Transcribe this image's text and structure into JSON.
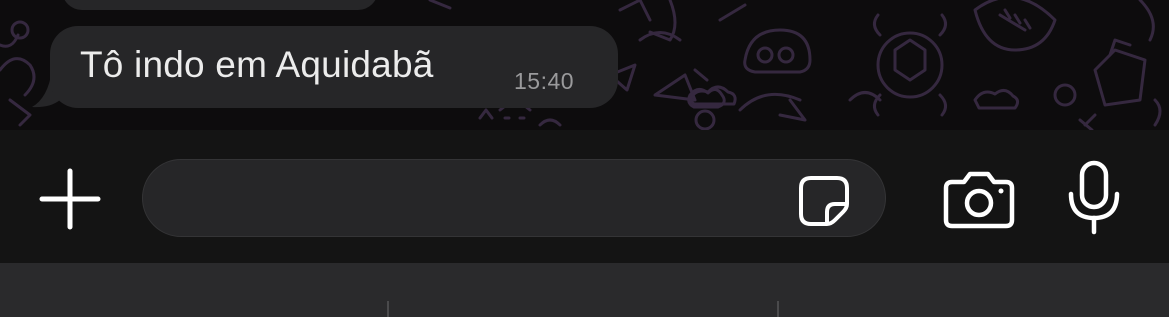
{
  "chat": {
    "message": {
      "text": "Tô indo em Aquidabã",
      "time": "15:40"
    }
  },
  "composer": {
    "value": "",
    "placeholder": ""
  },
  "icons": {
    "attach": "plus-icon",
    "sticker": "sticker-icon",
    "camera": "camera-icon",
    "mic": "microphone-icon"
  },
  "colors": {
    "bubble": "#262628",
    "wallpaper_doodle": "#3a2b45",
    "bar": "#141414",
    "icon": "#ffffff"
  }
}
